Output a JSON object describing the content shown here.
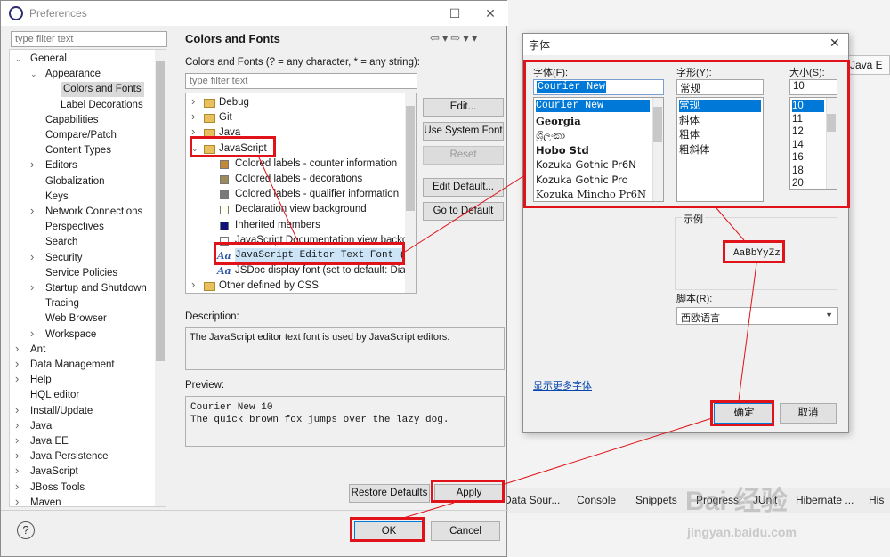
{
  "preferences": {
    "title": "Preferences",
    "filter_placeholder": "type filter text",
    "tree": [
      {
        "label": "General",
        "arrow": "down"
      },
      {
        "label": "Appearance",
        "arrow": "down"
      },
      {
        "label": "Colors and Fonts",
        "arrow": ""
      },
      {
        "label": "Label Decorations",
        "arrow": ""
      },
      {
        "label": "Capabilities",
        "arrow": ""
      },
      {
        "label": "Compare/Patch",
        "arrow": ""
      },
      {
        "label": "Content Types",
        "arrow": ""
      },
      {
        "label": "Editors",
        "arrow": "right"
      },
      {
        "label": "Globalization",
        "arrow": ""
      },
      {
        "label": "Keys",
        "arrow": ""
      },
      {
        "label": "Network Connections",
        "arrow": "right"
      },
      {
        "label": "Perspectives",
        "arrow": ""
      },
      {
        "label": "Search",
        "arrow": ""
      },
      {
        "label": "Security",
        "arrow": "right"
      },
      {
        "label": "Service Policies",
        "arrow": ""
      },
      {
        "label": "Startup and Shutdown",
        "arrow": "right"
      },
      {
        "label": "Tracing",
        "arrow": ""
      },
      {
        "label": "Web Browser",
        "arrow": ""
      },
      {
        "label": "Workspace",
        "arrow": "right"
      },
      {
        "label": "Ant",
        "arrow": "right"
      },
      {
        "label": "Data Management",
        "arrow": "right"
      },
      {
        "label": "Help",
        "arrow": "right"
      },
      {
        "label": "HQL editor",
        "arrow": ""
      },
      {
        "label": "Install/Update",
        "arrow": "right"
      },
      {
        "label": "Java",
        "arrow": "right"
      },
      {
        "label": "Java EE",
        "arrow": "right"
      },
      {
        "label": "Java Persistence",
        "arrow": "right"
      },
      {
        "label": "JavaScript",
        "arrow": "right"
      },
      {
        "label": "JBoss Tools",
        "arrow": "right"
      },
      {
        "label": "Maven",
        "arrow": "right"
      }
    ],
    "page_title": "Colors and Fonts",
    "cf_label": "Colors and Fonts (? = any character, * = any string):",
    "cf_filter_placeholder": "type filter text",
    "cf_tree": [
      {
        "label": "Debug",
        "kind": "folder",
        "arrow": "right"
      },
      {
        "label": "Git",
        "kind": "folder",
        "arrow": "right"
      },
      {
        "label": "Java",
        "kind": "folder",
        "arrow": "right"
      },
      {
        "label": "JavaScript",
        "kind": "folder",
        "arrow": "down"
      },
      {
        "label": "Colored labels - counter information",
        "kind": "swatch",
        "color": "#c08838"
      },
      {
        "label": "Colored labels - decorations",
        "kind": "swatch",
        "color": "#9c8a5a"
      },
      {
        "label": "Colored labels - qualifier information",
        "kind": "swatch",
        "color": "#7a7a7a"
      },
      {
        "label": "Declaration view background",
        "kind": "swatch",
        "color": "#fffff0"
      },
      {
        "label": "Inherited members",
        "kind": "swatch",
        "color": "#10107a"
      },
      {
        "label": "JavaScript Documentation view backgr",
        "kind": "swatch",
        "color": "#ffffff"
      },
      {
        "label": "JavaScript Editor Text Font (se",
        "kind": "font"
      },
      {
        "label": "JSDoc display font (set to default: Dial",
        "kind": "font"
      },
      {
        "label": "Other defined by CSS",
        "kind": "folder",
        "arrow": "right"
      }
    ],
    "buttons": {
      "edit": "Edit...",
      "use_system_font": "Use System Font",
      "reset": "Reset",
      "edit_default": "Edit Default...",
      "go_to_default": "Go to Default",
      "restore_defaults": "Restore Defaults",
      "apply": "Apply",
      "ok": "OK",
      "cancel": "Cancel"
    },
    "description_label": "Description:",
    "description": "The JavaScript editor text font is used by JavaScript editors.",
    "preview_label": "Preview:",
    "preview_line1": "Courier New 10",
    "preview_line2": "The quick brown fox jumps over the lazy dog.",
    "help_glyph": "?"
  },
  "font_dialog": {
    "title": "字体",
    "font_label": "字体(F):",
    "font_value": "Courier New",
    "fonts": [
      "Courier New",
      "Georgia",
      "ශ්‍රීලංකා",
      "Hobo Std",
      "Kozuka Gothic Pr6N",
      "Kozuka Gothic Pro",
      "Kozuka Mincho Pr6N"
    ],
    "style_label": "字形(Y):",
    "style_value": "常规",
    "styles": [
      "常规",
      "斜体",
      "粗体",
      "粗斜体"
    ],
    "size_label": "大小(S):",
    "size_value": "10",
    "sizes": [
      "10",
      "11",
      "12",
      "14",
      "16",
      "18",
      "20"
    ],
    "sample_label": "示例",
    "sample_text": "AaBbYyZz",
    "script_label": "脚本(R):",
    "script_value": "西欧语言",
    "more_fonts": "显示更多字体",
    "ok": "确定",
    "cancel": "取消"
  },
  "background": {
    "java_perspective": "Java E",
    "bottom_tabs": [
      "Data Sour...",
      "Console",
      "Snippets",
      "Progress",
      "JUnit",
      "Hibernate ...",
      "His"
    ]
  },
  "watermark": {
    "brand": "Bai 经验",
    "url": "jingyan.baidu.com"
  },
  "colors": {
    "annotation_red": "#e0121a",
    "selection_blue": "#0078d7",
    "link_blue": "#0645ad"
  }
}
